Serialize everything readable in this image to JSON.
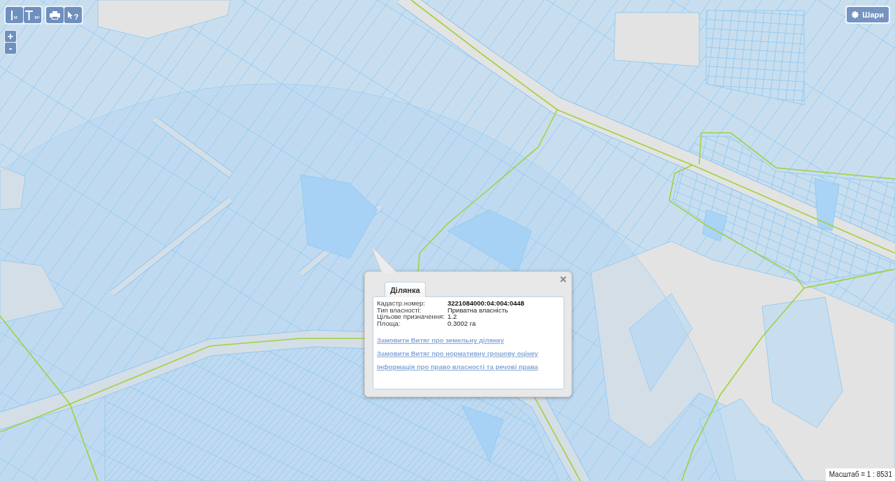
{
  "toolbar": {
    "groups": [
      {
        "buttons": [
          {
            "kind": "distance",
            "label": "м"
          },
          {
            "kind": "area",
            "label": "м²"
          }
        ]
      },
      {
        "buttons": [
          {
            "kind": "print"
          },
          {
            "kind": "identify",
            "label": "?"
          }
        ]
      }
    ]
  },
  "zoom": {
    "buttons": [
      "+",
      "-"
    ]
  },
  "layers_button": {
    "label": "Шари"
  },
  "popup": {
    "tabs": [
      {
        "label": "Ділянка",
        "selected": true
      }
    ],
    "fields": [
      {
        "label": "Кадастр.номер:",
        "value": "3221084000:04:004:0448",
        "bold": true
      },
      {
        "label": "Тип власності:",
        "value": "Приватна власність",
        "bold": false
      },
      {
        "label": "Цільове призначення:",
        "value": "1.2",
        "bold": false
      },
      {
        "label": "Площа:",
        "value": "0.3002 га",
        "bold": false
      }
    ],
    "links": [
      "Замовити Витяг про земельну ділянку",
      "Замовити Витяг про нормативну грошову оцінку",
      "Інформація про право власності та речові права"
    ]
  },
  "scale_label": "Масштаб = 1 : 8531"
}
